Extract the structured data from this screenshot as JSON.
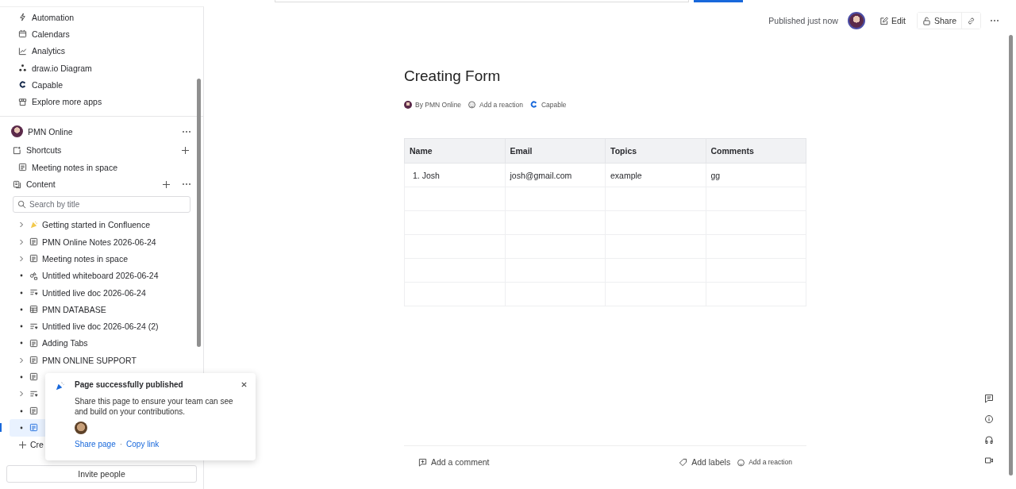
{
  "sidebar": {
    "apps": [
      {
        "label": "Automation",
        "kind": "bolt"
      },
      {
        "label": "Calendars",
        "kind": "calendar"
      },
      {
        "label": "Analytics",
        "kind": "chart"
      },
      {
        "label": "draw.io Diagram",
        "kind": "nodes"
      },
      {
        "label": "Capable",
        "kind": "capable"
      },
      {
        "label": "Explore more apps",
        "kind": "store"
      }
    ],
    "space": {
      "name": "PMN Online"
    },
    "shortcuts": {
      "label": "Shortcuts",
      "items": [
        {
          "label": "Meeting notes in space",
          "kind": "page"
        }
      ]
    },
    "content": {
      "label": "Content",
      "search_placeholder": "Search by title",
      "tree": [
        {
          "has_children": true,
          "kind": "emoji",
          "label": "Getting started in Confluence",
          "selected": false
        },
        {
          "has_children": true,
          "kind": "page",
          "label": "PMN Online Notes 2026-06-24",
          "selected": false
        },
        {
          "has_children": true,
          "kind": "page",
          "label": "Meeting notes in space",
          "selected": false
        },
        {
          "has_children": false,
          "kind": "whiteboard",
          "label": "Untitled whiteboard 2026-06-24",
          "selected": false
        },
        {
          "has_children": false,
          "kind": "livedoc",
          "label": "Untitled live doc 2026-06-24",
          "selected": false
        },
        {
          "has_children": false,
          "kind": "database",
          "label": "PMN DATABASE",
          "selected": false
        },
        {
          "has_children": false,
          "kind": "livedoc",
          "label": "Untitled live doc 2026-06-24 (2)",
          "selected": false
        },
        {
          "has_children": false,
          "kind": "page",
          "label": "Adding Tabs",
          "selected": false
        },
        {
          "has_children": true,
          "kind": "page",
          "label": "PMN ONLINE SUPPORT",
          "selected": false
        },
        {
          "has_children": false,
          "kind": "page",
          "selected": false
        },
        {
          "has_children": true,
          "kind": "livedoc",
          "selected": false
        },
        {
          "has_children": false,
          "kind": "page",
          "selected": false
        },
        {
          "has_children": false,
          "kind": "page",
          "selected": true
        }
      ],
      "create_label": "Cre"
    },
    "invite_button": "Invite people"
  },
  "header": {
    "status": "Published just now",
    "edit": "Edit",
    "share": "Share"
  },
  "page": {
    "title": "Creating Form",
    "byline": "By PMN Online",
    "reaction": "Add a reaction",
    "app": "Capable",
    "table": {
      "columns": [
        "Name",
        "Email",
        "Topics",
        "Comments"
      ],
      "rows": [
        [
          "1. Josh",
          "josh@gmail.com",
          "example",
          "gg"
        ]
      ]
    }
  },
  "footer": {
    "comment": "Add a comment",
    "labels": "Add labels",
    "reaction": "Add a reaction"
  },
  "toast": {
    "title": "Page successfully published",
    "message": "Share this page to ensure your team can see and build on your contributions.",
    "share_link": "Share page",
    "separator": "·",
    "copy_link": "Copy link"
  }
}
